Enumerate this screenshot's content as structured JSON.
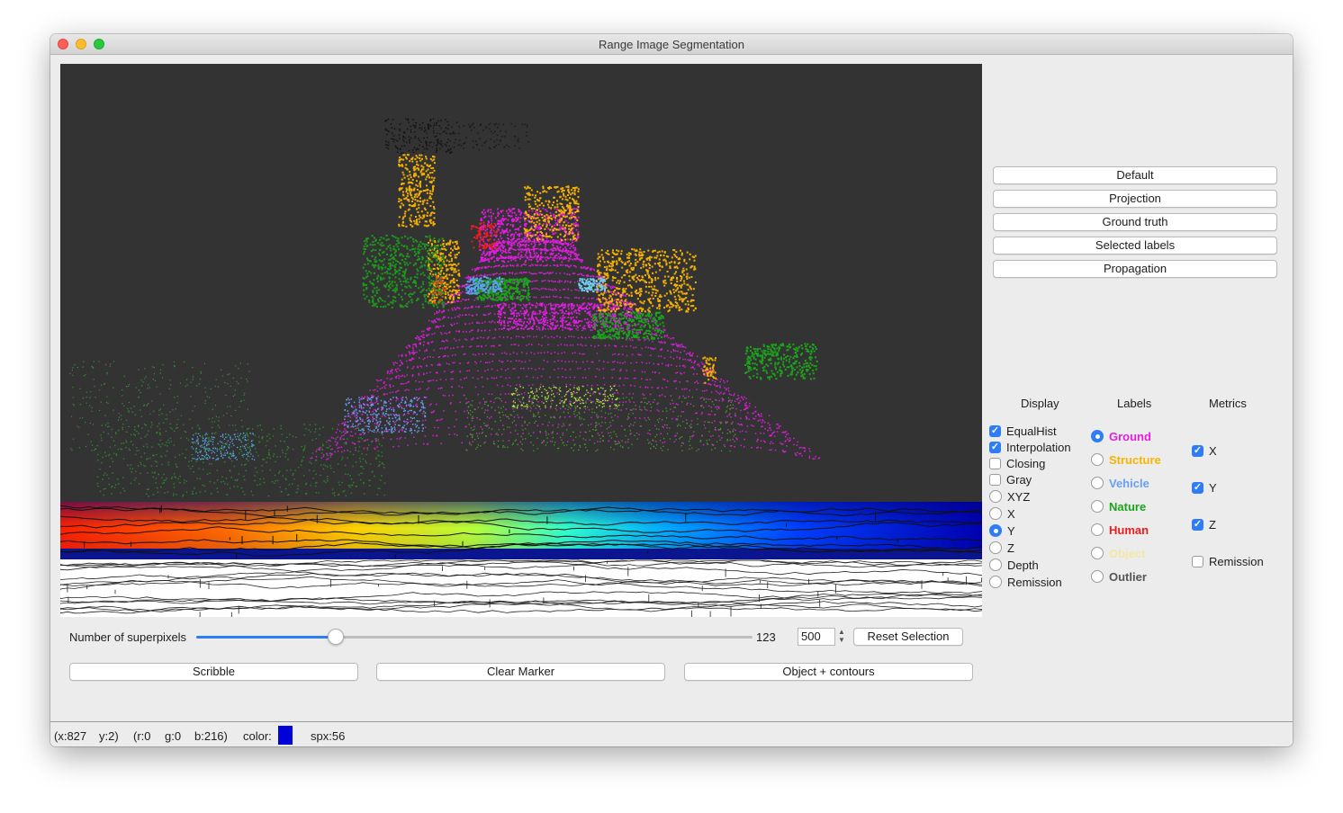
{
  "window": {
    "title": "Range Image Segmentation"
  },
  "view_buttons": [
    "Default",
    "Projection",
    "Ground truth",
    "Selected labels",
    "Propagation"
  ],
  "display": {
    "header": "Display",
    "options": [
      {
        "label": "EqualHist",
        "kind": "checkbox",
        "checked": true
      },
      {
        "label": "Interpolation",
        "kind": "checkbox",
        "checked": true
      },
      {
        "label": "Closing",
        "kind": "checkbox",
        "checked": false
      },
      {
        "label": "Gray",
        "kind": "checkbox",
        "checked": false
      },
      {
        "label": "XYZ",
        "kind": "radio",
        "checked": false
      },
      {
        "label": "X",
        "kind": "radio",
        "checked": false
      },
      {
        "label": "Y",
        "kind": "radio",
        "checked": true
      },
      {
        "label": "Z",
        "kind": "radio",
        "checked": false
      },
      {
        "label": "Depth",
        "kind": "radio",
        "checked": false
      },
      {
        "label": "Remission",
        "kind": "radio",
        "checked": false
      }
    ]
  },
  "labels": {
    "header": "Labels",
    "options": [
      {
        "label": "Ground",
        "color": "#e61ce6",
        "checked": true
      },
      {
        "label": "Structure",
        "color": "#f7b500",
        "checked": false
      },
      {
        "label": "Vehicle",
        "color": "#6a9ff0",
        "checked": false
      },
      {
        "label": "Nature",
        "color": "#1aa51a",
        "checked": false
      },
      {
        "label": "Human",
        "color": "#ee1c1c",
        "checked": false
      },
      {
        "label": "Object",
        "color": "#f3e7a6",
        "checked": false
      },
      {
        "label": "Outlier",
        "color": "#555555",
        "checked": false
      }
    ]
  },
  "metrics": {
    "header": "Metrics",
    "options": [
      {
        "label": "X",
        "checked": true
      },
      {
        "label": "Y",
        "checked": true
      },
      {
        "label": "Z",
        "checked": true
      },
      {
        "label": "Remission",
        "checked": false
      }
    ]
  },
  "superpixels": {
    "label": "Number of superpixels",
    "slider_value": 123,
    "slider_fraction": 0.25,
    "spin_value": "500",
    "reset_label": "Reset Selection"
  },
  "actions": [
    "Scribble",
    "Clear Marker",
    "Object + contours"
  ],
  "status": {
    "x": "(x:827",
    "y": "y:2)",
    "r": "(r:0",
    "g": "g:0",
    "b": "b:216)",
    "color_label": "color:",
    "color_value": "#0000d8",
    "spx": "spx:56"
  },
  "colors": {
    "accent": "#2f7df6",
    "viewer_bg": "#333333"
  }
}
